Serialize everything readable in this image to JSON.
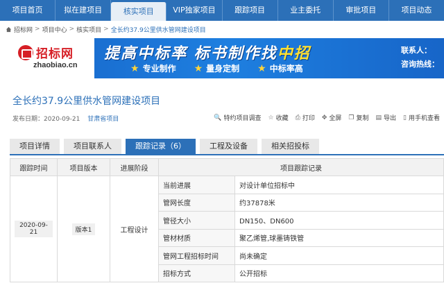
{
  "nav": {
    "items": [
      "项目首页",
      "拟在建项目",
      "核实项目",
      "VIP独家项目",
      "跟踪项目",
      "业主委托",
      "审批项目",
      "项目动态"
    ],
    "active_index": 2
  },
  "breadcrumb": [
    "招标网",
    "项目中心",
    "核实项目",
    "全长约37.9公里供水管网建设项目"
  ],
  "banner": {
    "logo_cn": "招标网",
    "logo_en": "zhaobiao.cn",
    "slogan_prefix": "提高中标率 标书制作找",
    "slogan_highlight": "中招",
    "features": [
      "专业制作",
      "量身定制",
      "中标率高"
    ],
    "contact_label": "联系人：",
    "hotline_label": "咨询热线："
  },
  "project": {
    "title": "全长约37.9公里供水管网建设项目",
    "date_label": "发布日期：",
    "date": "2020-09-21",
    "region": "甘肃省项目"
  },
  "actions": [
    "特约项目调查",
    "收藏",
    "打印",
    "全屏",
    "复制",
    "导出",
    "用手机查看"
  ],
  "tabs": [
    "项目详情",
    "项目联系人",
    "跟踪记录（6）",
    "工程及设备",
    "相关招投标"
  ],
  "active_tab": 2,
  "table": {
    "headers": [
      "跟踪时间",
      "项目版本",
      "进展阶段",
      "项目跟踪记录"
    ],
    "time": "2020-09-21",
    "version": "版本1",
    "stage": "工程设计",
    "rows": [
      {
        "k": "当前进展",
        "v": "对设计单位招标中"
      },
      {
        "k": "管网长度",
        "v": "约37878米"
      },
      {
        "k": "管径大小",
        "v": "DN150、DN600"
      },
      {
        "k": "管材材质",
        "v": "聚乙烯管,球墨铸铁管"
      },
      {
        "k": "管网工程招标时间",
        "v": "尚未确定"
      },
      {
        "k": "招标方式",
        "v": "公开招标"
      }
    ]
  },
  "colors": {
    "primary": "#2c70b8",
    "banner": "#1765c8",
    "logo_red": "#d61f26",
    "highlight": "#ffe033"
  }
}
